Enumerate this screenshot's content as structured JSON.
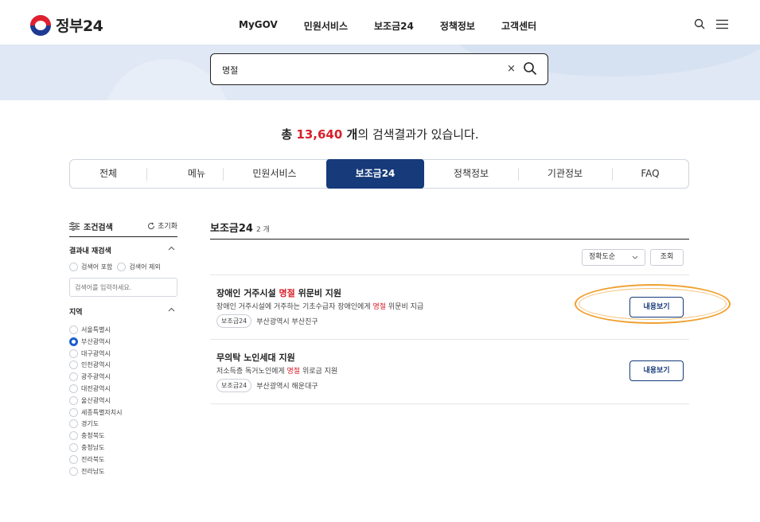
{
  "header": {
    "logo_text": "정부24",
    "nav": [
      "MyGOV",
      "민원서비스",
      "보조금24",
      "정책정보",
      "고객센터"
    ]
  },
  "search": {
    "value": "명절",
    "clear_label": "×"
  },
  "summary": {
    "prefix": "총 ",
    "count": "13,640",
    "unit": " 개",
    "suffix": "의 검색결과가 있습니다."
  },
  "tabs": [
    {
      "label": "전체"
    },
    {
      "label": "메뉴"
    },
    {
      "label": "민원서비스"
    },
    {
      "label": "보조금24",
      "active": true
    },
    {
      "label": "정책정보"
    },
    {
      "label": "기관정보"
    },
    {
      "label": "FAQ"
    }
  ],
  "sidebar": {
    "filter_label": "조건검색",
    "reset_label": "초기화",
    "refine_title": "결과내 재검색",
    "include_label": "검색어 포함",
    "exclude_label": "검색어 제외",
    "input_placeholder": "검색어를 입력하세요.",
    "region_title": "지역",
    "regions": [
      "서울특별시",
      "부산광역시",
      "대구광역시",
      "인천광역시",
      "광주광역시",
      "대전광역시",
      "울산광역시",
      "세종특별자치시",
      "경기도",
      "충청북도",
      "충청남도",
      "전라북도",
      "전라남도"
    ],
    "selected_region": "부산광역시"
  },
  "main": {
    "title": "보조금24",
    "count_label": "2 개",
    "sort_value": "정확도순",
    "query_button": "조회",
    "results": [
      {
        "title_a": "장애인 거주시설 ",
        "title_hl": "명절",
        "title_b": " 위문비 지원",
        "desc_a": "장애인 거주시설에 거주하는 기초수급자 장애인에게 ",
        "desc_hl": "명절",
        "desc_b": " 위문비 지급",
        "badge": "보조금24",
        "location": "부산광역시 부산진구",
        "button": "내용보기"
      },
      {
        "title_a": "무의탁 노인세대 지원",
        "title_hl": "",
        "title_b": "",
        "desc_a": "저소득층 독거노인에게 ",
        "desc_hl": "명절",
        "desc_b": " 위로금 지원",
        "badge": "보조금24",
        "location": "부산광역시 해운대구",
        "button": "내용보기"
      }
    ]
  },
  "colors": {
    "accent": "#163a7a",
    "highlight": "#d81f2a",
    "selected_radio": "#1a5fd0",
    "annotation_ring": "#f0a030"
  }
}
